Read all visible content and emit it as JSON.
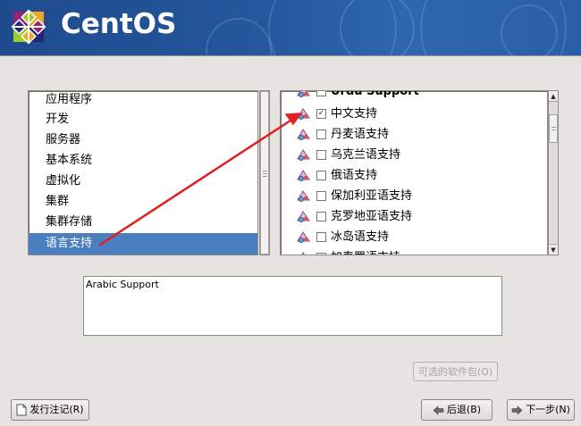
{
  "banner": {
    "brand": "CentOS"
  },
  "categories": [
    {
      "label": "应用程序",
      "selected": false
    },
    {
      "label": "开发",
      "selected": false
    },
    {
      "label": "服务器",
      "selected": false
    },
    {
      "label": "基本系统",
      "selected": false
    },
    {
      "label": "虚拟化",
      "selected": false
    },
    {
      "label": "集群",
      "selected": false
    },
    {
      "label": "集群存储",
      "selected": false
    },
    {
      "label": "语言支持",
      "selected": true
    }
  ],
  "packages": [
    {
      "label": "Urdu Support",
      "checked": false
    },
    {
      "label": "中文支持",
      "checked": true
    },
    {
      "label": "丹麦语支持",
      "checked": false
    },
    {
      "label": "乌克兰语支持",
      "checked": false
    },
    {
      "label": "俄语支持",
      "checked": false
    },
    {
      "label": "保加利亚语支持",
      "checked": false
    },
    {
      "label": "克罗地亚语支持",
      "checked": false
    },
    {
      "label": "冰岛语支持",
      "checked": false
    },
    {
      "label": "加泰罗语支持",
      "checked": false
    }
  ],
  "description": "Arabic Support",
  "buttons": {
    "optional_packages": "可选的软件包(O)",
    "release_notes": "发行注记(R)",
    "back": "后退(B)",
    "next": "下一步(N)"
  },
  "colors": {
    "banner": "#24579c",
    "selection": "#4b7fc1",
    "annotation_arrow": "#e02020"
  },
  "icons": {
    "package": "package-group-icon",
    "release_notes": "document-icon",
    "back": "back-arrow-icon",
    "next": "forward-arrow-icon"
  }
}
